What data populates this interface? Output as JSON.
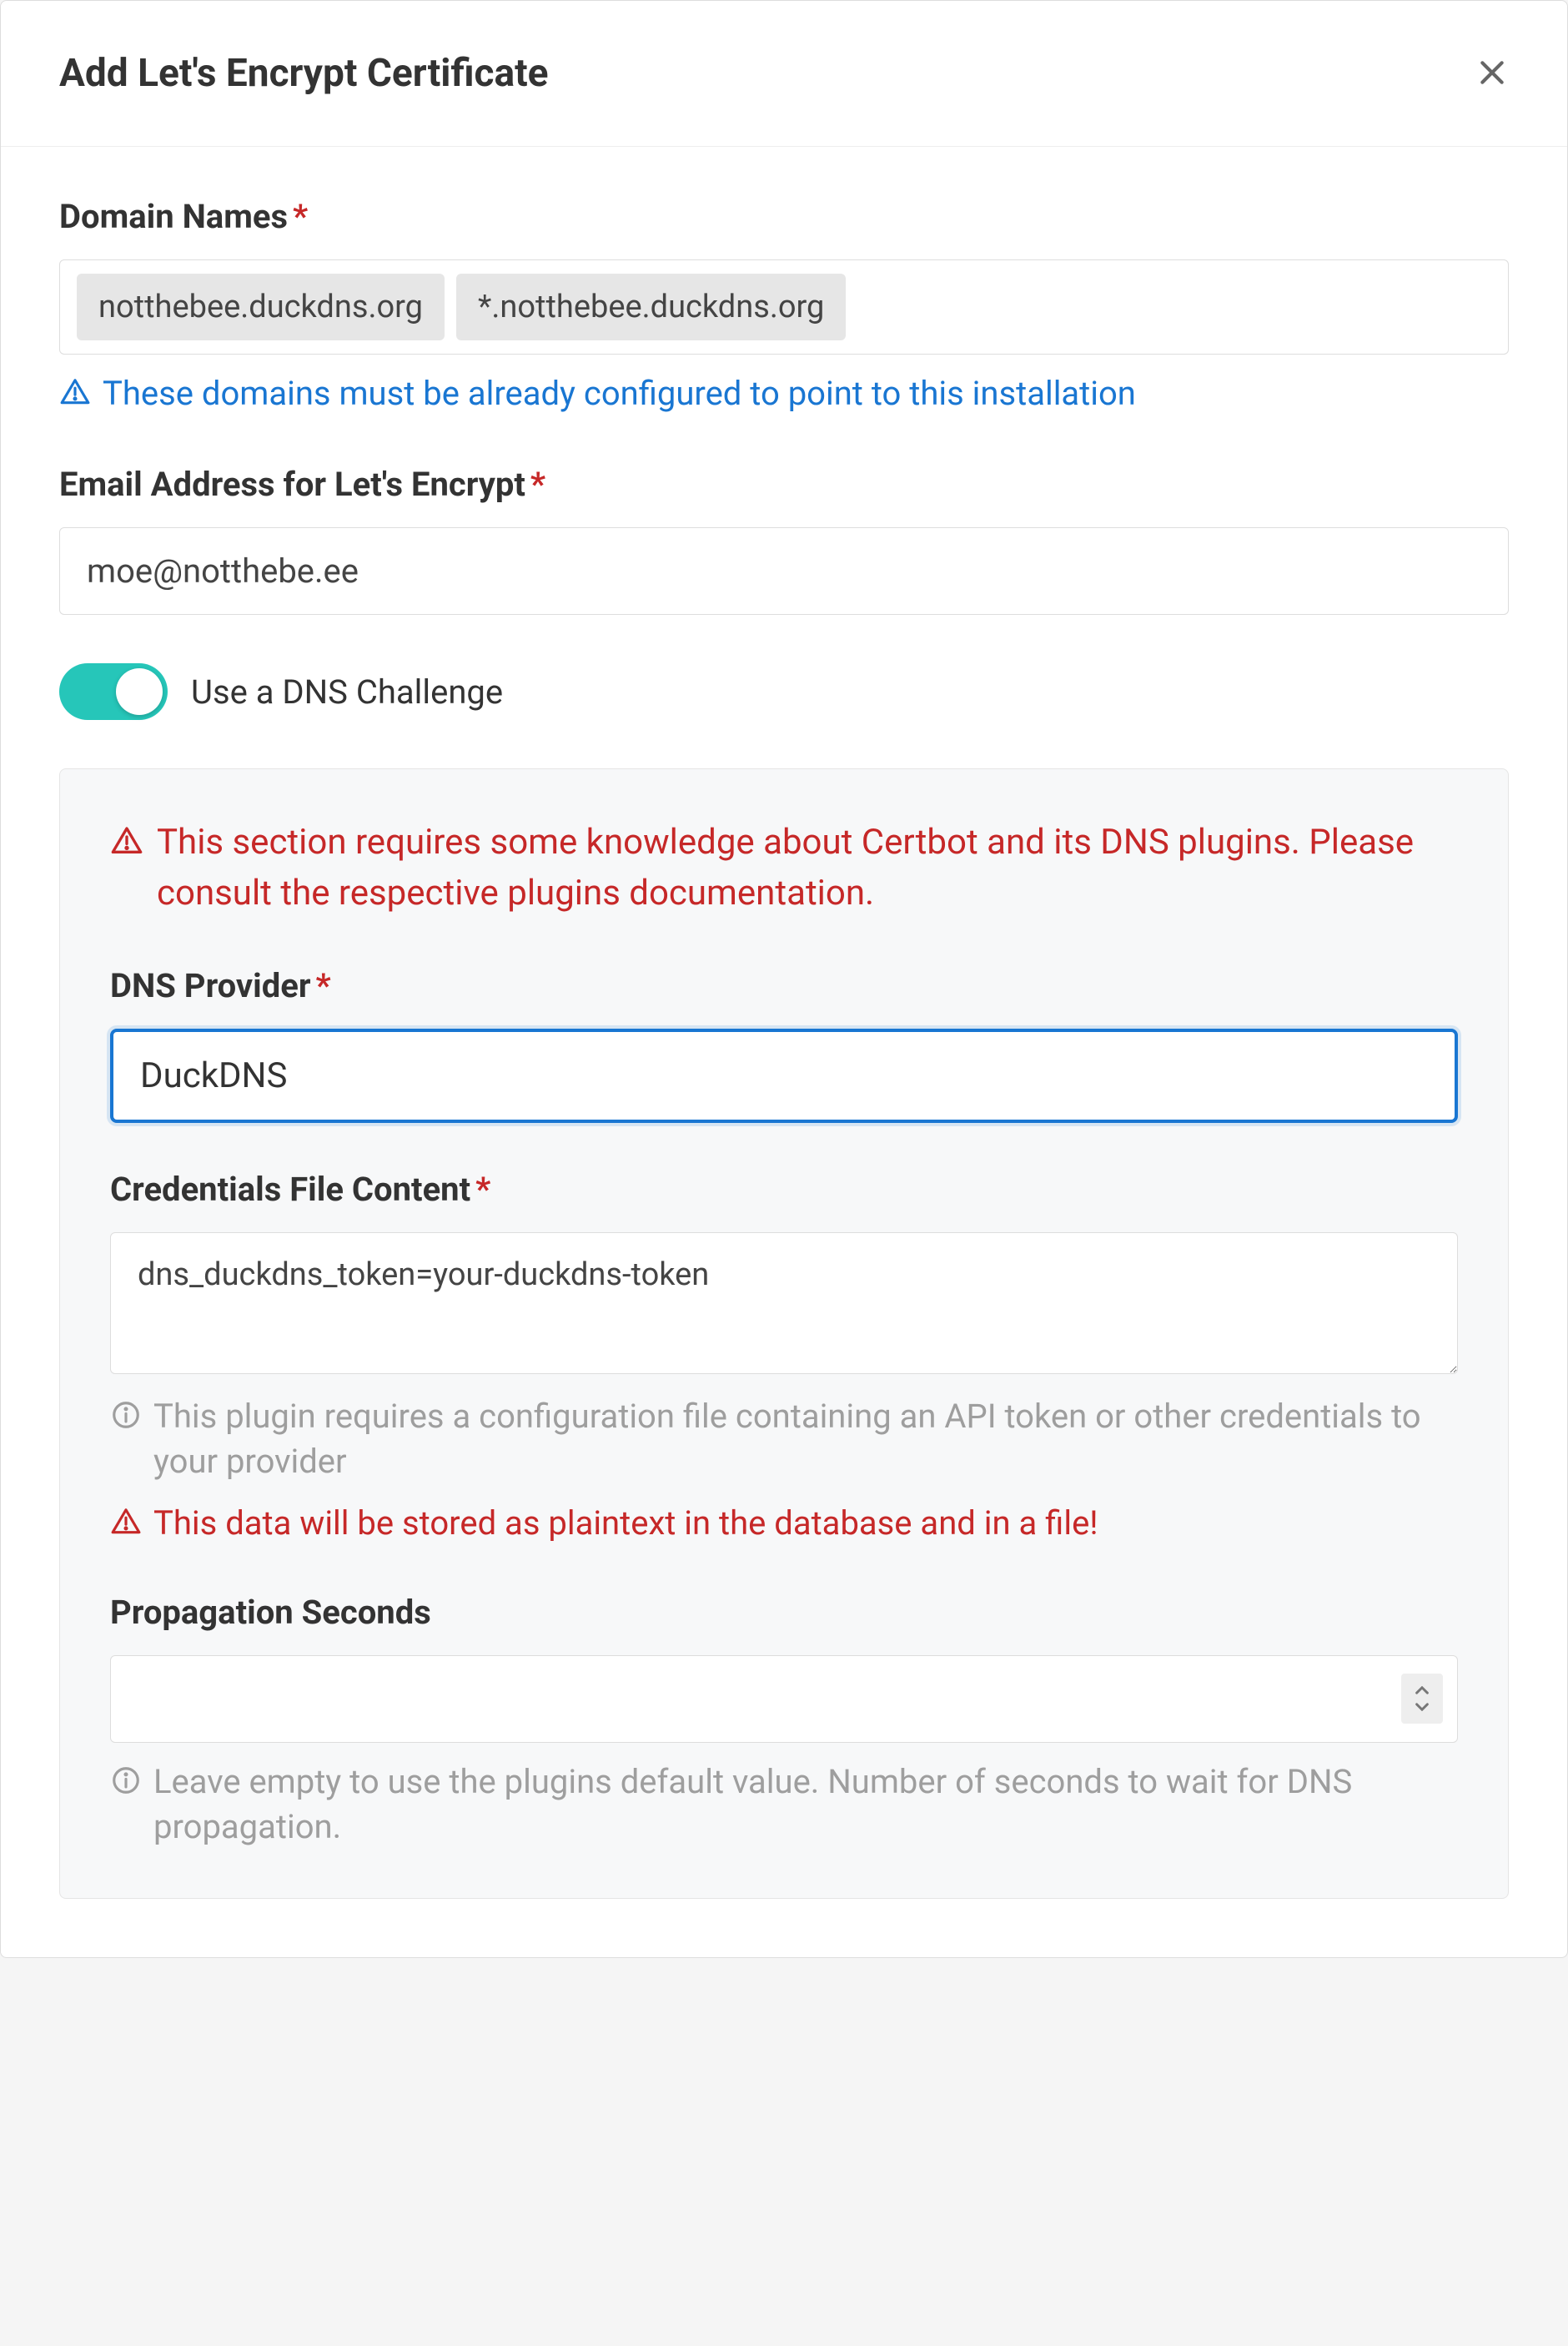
{
  "modal": {
    "title": "Add Let's Encrypt Certificate"
  },
  "domainNames": {
    "label": "Domain Names",
    "tags": [
      "notthebee.duckdns.org",
      "*.notthebee.duckdns.org"
    ],
    "help": "These domains must be already configured to point to this installation"
  },
  "email": {
    "label": "Email Address for Let's Encrypt",
    "value": "moe@notthebe.ee"
  },
  "dnsChallenge": {
    "label": "Use a DNS Challenge",
    "enabled": true
  },
  "panel": {
    "warning": "This section requires some knowledge about Certbot and its DNS plugins. Please consult the respective plugins documentation.",
    "dnsProvider": {
      "label": "DNS Provider",
      "value": "DuckDNS"
    },
    "credentials": {
      "label": "Credentials File Content",
      "value": "dns_duckdns_token=your-duckdns-token",
      "helpInfo": "This plugin requires a configuration file containing an API token or other credentials to your provider",
      "helpWarn": "This data will be stored as plaintext in the database and in a file!"
    },
    "propagation": {
      "label": "Propagation Seconds",
      "value": "",
      "help": "Leave empty to use the plugins default value. Number of seconds to wait for DNS propagation."
    }
  }
}
